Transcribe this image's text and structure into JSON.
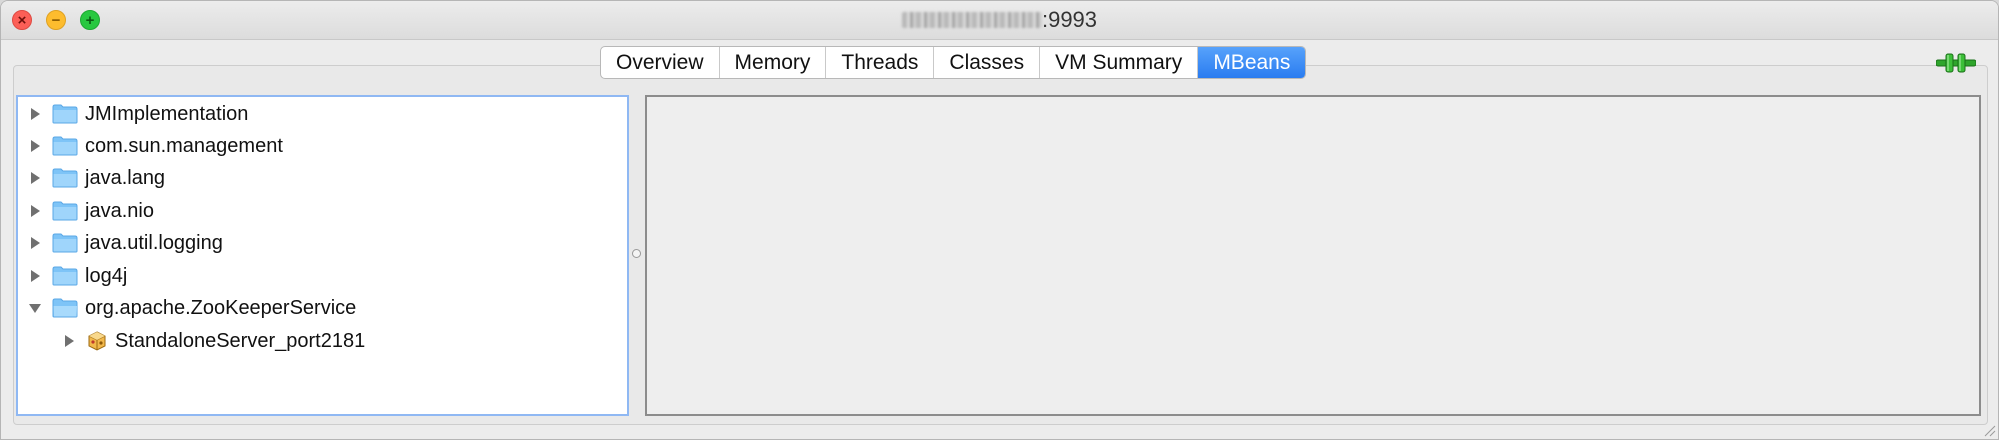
{
  "window": {
    "title_suffix": ":9993",
    "title_redacted": "blurred host address"
  },
  "tabs": [
    {
      "label": "Overview",
      "active": false
    },
    {
      "label": "Memory",
      "active": false
    },
    {
      "label": "Threads",
      "active": false
    },
    {
      "label": "Classes",
      "active": false
    },
    {
      "label": "VM Summary",
      "active": false
    },
    {
      "label": "MBeans",
      "active": true
    }
  ],
  "tree": {
    "items": [
      {
        "label": "JMImplementation",
        "expanded": false,
        "type": "folder"
      },
      {
        "label": "com.sun.management",
        "expanded": false,
        "type": "folder"
      },
      {
        "label": "java.lang",
        "expanded": false,
        "type": "folder"
      },
      {
        "label": "java.nio",
        "expanded": false,
        "type": "folder"
      },
      {
        "label": "java.util.logging",
        "expanded": false,
        "type": "folder"
      },
      {
        "label": "log4j",
        "expanded": false,
        "type": "folder"
      },
      {
        "label": "org.apache.ZooKeeperService",
        "expanded": true,
        "type": "folder"
      },
      {
        "label": "StandaloneServer_port2181",
        "expanded": false,
        "type": "bean"
      }
    ]
  },
  "colors": {
    "accent": "#2a7cf0",
    "folder": "#7ec4f7",
    "close": "#fc5f57",
    "minimize": "#fdbc2e",
    "maximize": "#28c840",
    "connection": "#2fa52c"
  },
  "icons": {
    "close": "close-icon",
    "minimize": "minimize-icon",
    "maximize": "maximize-icon",
    "connection": "connection-plug-icon",
    "folder": "folder-icon",
    "bean": "mbean-icon",
    "collapsed": "triangle-right-icon",
    "expanded": "triangle-down-icon"
  }
}
